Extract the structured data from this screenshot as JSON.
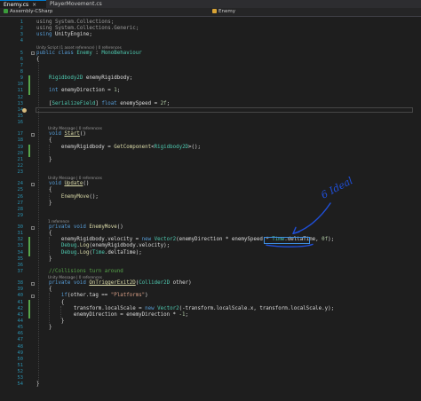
{
  "tabs": [
    {
      "label": "Enemy.cs",
      "close": "×",
      "active": true
    },
    {
      "label": "PlayerMovement.cs",
      "active": false
    }
  ],
  "nav": {
    "project": "Assembly-CSharp",
    "class": "Enemy"
  },
  "annotation": "6 Ideal",
  "lines": [
    {
      "n": "1",
      "html": "<span class=\"gy\">using</span> <span class=\"gy\">System.Collections;</span>"
    },
    {
      "n": "2",
      "html": "<span class=\"gy\">using</span> <span class=\"gy\">System.Collections.Generic;</span>"
    },
    {
      "n": "3",
      "html": "<span class=\"kw\">using</span> UnityEngine;"
    },
    {
      "n": "4",
      "html": ""
    },
    {
      "n": "5",
      "html": "<span class=\"kw\">public class</span> <span class=\"ty\">Enemy</span> : <span class=\"ty\">MonoBehaviour</span>"
    },
    {
      "n": "6",
      "html": "{"
    },
    {
      "n": "7",
      "html": ""
    },
    {
      "n": "8",
      "html": ""
    },
    {
      "n": "9",
      "html": "    <span class=\"ty\">Rigidbody2D</span> enemyRigidbody;"
    },
    {
      "n": "10",
      "html": ""
    },
    {
      "n": "11",
      "html": "    <span class=\"kw\">int</span> enemyDirection = <span class=\"num\">1</span>;"
    },
    {
      "n": "12",
      "html": ""
    },
    {
      "n": "13",
      "html": "    [<span class=\"ty\">SerializeField</span>] <span class=\"kw\">float</span> enemySpeed = <span class=\"num\">2f</span>;"
    },
    {
      "n": "14",
      "html": ""
    },
    {
      "n": "15",
      "html": ""
    },
    {
      "n": "16",
      "html": ""
    },
    {
      "n": "17",
      "html": "    <span class=\"kw\">void</span> <span class=\"fn und\">Start</span>()"
    },
    {
      "n": "18",
      "html": "    {"
    },
    {
      "n": "19",
      "html": "        enemyRigidbody = <span class=\"fn\">GetComponent</span>&lt;<span class=\"ty\">Rigidbody2D</span>&gt;();"
    },
    {
      "n": "20",
      "html": ""
    },
    {
      "n": "21",
      "html": "    }"
    },
    {
      "n": "22",
      "html": ""
    },
    {
      "n": "23",
      "html": ""
    },
    {
      "n": "24",
      "html": "    <span class=\"kw\">void</span> <span class=\"fn und\">Update</span>()"
    },
    {
      "n": "25",
      "html": "    {"
    },
    {
      "n": "26",
      "html": "        <span class=\"fn\">EnemyMove</span>();"
    },
    {
      "n": "27",
      "html": "    }"
    },
    {
      "n": "28",
      "html": ""
    },
    {
      "n": "29",
      "html": ""
    },
    {
      "n": "30",
      "html": "    <span class=\"kw\">private void</span> <span class=\"fn\">EnemyMove</span>()"
    },
    {
      "n": "31",
      "html": "    {"
    },
    {
      "n": "32",
      "html": "        enemyRigidbody.velocity = <span class=\"kw\">new</span> <span class=\"ty\">Vector2</span>(enemyDirection * enemySpeed * <span class=\"ty\">Time</span>.deltaTime, <span class=\"num\">0f</span>);"
    },
    {
      "n": "33",
      "html": "        <span class=\"ty\">Debug</span>.<span class=\"fn\">Log</span>(enemyRigidbody.velocity);"
    },
    {
      "n": "34",
      "html": "        <span class=\"ty\">Debug</span>.<span class=\"fn\">Log</span>(<span class=\"ty\">Time</span>.deltaTime);"
    },
    {
      "n": "35",
      "html": "    }"
    },
    {
      "n": "36",
      "html": ""
    },
    {
      "n": "37",
      "html": "    <span class=\"cm\">//Collisions turn around</span>"
    },
    {
      "n": "38",
      "html": "    <span class=\"kw\">private void</span> <span class=\"fn und\">OnTriggerExit2D</span>(<span class=\"ty\">Collider2D</span> other)"
    },
    {
      "n": "39",
      "html": "    {"
    },
    {
      "n": "40",
      "html": "        <span class=\"kw\">if</span>(other.tag == <span class=\"str\">\"Platforms\"</span>)"
    },
    {
      "n": "41",
      "html": "        {"
    },
    {
      "n": "42",
      "html": "            transform.localScale = <span class=\"kw\">new</span> <span class=\"ty\">Vector2</span>(-transform.localScale.x, transform.localScale.y);"
    },
    {
      "n": "43",
      "html": "            enemyDirection = enemyDirection * <span class=\"num\">-1</span>;"
    },
    {
      "n": "44",
      "html": "        }"
    },
    {
      "n": "45",
      "html": "    }"
    },
    {
      "n": "46",
      "html": ""
    },
    {
      "n": "47",
      "html": ""
    },
    {
      "n": "48",
      "html": ""
    },
    {
      "n": "49",
      "html": ""
    },
    {
      "n": "50",
      "html": ""
    },
    {
      "n": "51",
      "html": ""
    },
    {
      "n": "52",
      "html": ""
    },
    {
      "n": "53",
      "html": ""
    },
    {
      "n": "54",
      "html": "}"
    }
  ],
  "lens": {
    "script": "Unity Script (1 asset reference) | 0 references",
    "start": "Unity Message | 0 references",
    "update": "Unity Message | 0 references",
    "enemymove": "1 reference",
    "trigger": "Unity Message | 0 references"
  },
  "changed_lines": [
    "9",
    "10",
    "11",
    "19",
    "20",
    "32",
    "33",
    "34",
    "41",
    "42",
    "43"
  ],
  "colors": {
    "background": "#1e1e1e",
    "keyword": "#569cd6",
    "type": "#4ec9b0",
    "string": "#d69d85",
    "number": "#b5cea8",
    "comment": "#57a64a",
    "linenumber": "#2b91af",
    "annotation_ink": "#1f4fd8"
  }
}
